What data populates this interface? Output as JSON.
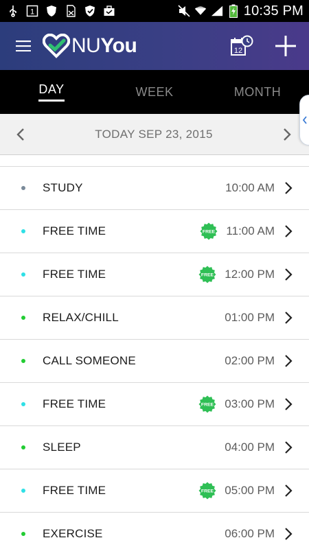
{
  "status_bar": {
    "time": "10:35 PM",
    "icons": [
      "usb-icon",
      "notification-1-icon",
      "shield-icon",
      "no-sim-icon",
      "shield-check-icon",
      "briefcase-icon",
      "mute-icon",
      "wifi-icon",
      "signal-icon",
      "battery-charging-icon"
    ],
    "notification_count": "1"
  },
  "app_bar": {
    "logo_text_light": "NU",
    "logo_text_bold": "You",
    "calendar_day": "12",
    "accent": "#2fbf71"
  },
  "tabs": [
    {
      "label": "DAY",
      "active": true
    },
    {
      "label": "WEEK",
      "active": false
    },
    {
      "label": "MONTH",
      "active": false
    }
  ],
  "date_nav": {
    "label": "TODAY SEP 23, 2015"
  },
  "badge_text": "FREE",
  "schedule": [
    {
      "title": "STUDY",
      "time": "10:00 AM",
      "dot_color": "#7a8a99",
      "free": false
    },
    {
      "title": "FREE TIME",
      "time": "11:00 AM",
      "dot_color": "#2fe0e6",
      "free": true
    },
    {
      "title": "FREE TIME",
      "time": "12:00 PM",
      "dot_color": "#2fe0e6",
      "free": true
    },
    {
      "title": "RELAX/CHILL",
      "time": "01:00 PM",
      "dot_color": "#22cc33",
      "free": false
    },
    {
      "title": "CALL SOMEONE",
      "time": "02:00 PM",
      "dot_color": "#22cc33",
      "free": false
    },
    {
      "title": "FREE TIME",
      "time": "03:00 PM",
      "dot_color": "#2fe0e6",
      "free": true
    },
    {
      "title": "SLEEP",
      "time": "04:00 PM",
      "dot_color": "#22cc33",
      "free": false
    },
    {
      "title": "FREE TIME",
      "time": "05:00 PM",
      "dot_color": "#2fe0e6",
      "free": true
    },
    {
      "title": "EXERCISE",
      "time": "06:00 PM",
      "dot_color": "#22cc33",
      "free": false
    }
  ]
}
